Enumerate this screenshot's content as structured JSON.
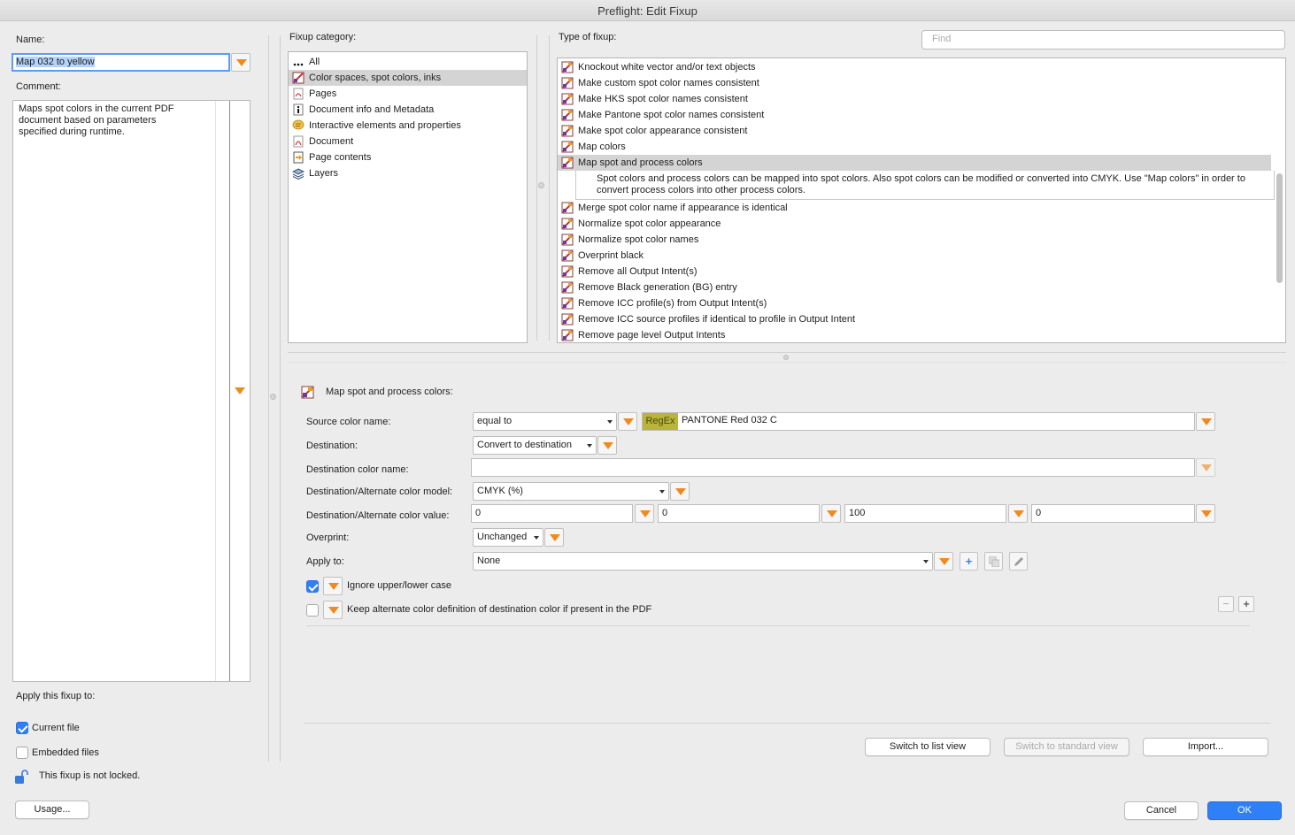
{
  "window": {
    "title": "Preflight: Edit Fixup"
  },
  "left": {
    "name_label": "Name:",
    "name_value": "Map 032 to yellow",
    "comment_label": "Comment:",
    "comment_value": "Maps spot colors in the current PDF document based on parameters specified during runtime.",
    "apply_label": "Apply this fixup to:",
    "current_file": "Current file",
    "embedded_files": "Embedded files",
    "lock_text": "This fixup is not locked.",
    "usage_button": "Usage..."
  },
  "category": {
    "label": "Fixup category:",
    "items": [
      {
        "label": "All",
        "icon": "dots-icon"
      },
      {
        "label": "Color spaces, spot colors, inks",
        "icon": "color-palette-icon",
        "selected": true
      },
      {
        "label": "Pages",
        "icon": "pdf-page-icon"
      },
      {
        "label": "Document info and Metadata",
        "icon": "info-icon"
      },
      {
        "label": "Interactive elements and properties",
        "icon": "comment-bubble-icon"
      },
      {
        "label": "Document",
        "icon": "pdf-document-icon"
      },
      {
        "label": "Page contents",
        "icon": "page-contents-icon"
      },
      {
        "label": "Layers",
        "icon": "layers-icon"
      }
    ]
  },
  "types": {
    "label": "Type of fixup:",
    "find_placeholder": "Find",
    "items": [
      "Knockout white vector and/or text objects",
      "Make custom spot color names consistent",
      "Make HKS spot color names consistent",
      "Make Pantone spot color names consistent",
      "Make spot color appearance consistent",
      "Map colors",
      "Map spot and process colors",
      "Merge spot color name if appearance is identical",
      "Normalize spot color appearance",
      "Normalize spot color names",
      "Overprint black",
      "Remove all Output Intent(s)",
      "Remove Black generation (BG) entry",
      "Remove ICC profile(s) from Output Intent(s)",
      "Remove ICC source profiles if identical to profile in Output Intent",
      "Remove page level Output Intents"
    ],
    "selected_index": 6,
    "selected_description": "Spot colors and process colors can be mapped into spot colors. Also spot colors can be modified or converted into CMYK. Use \"Map colors\" in order to convert process colors into other process colors."
  },
  "params": {
    "header": "Map spot and process colors:",
    "source_label": "Source color name:",
    "source_op": "equal to",
    "regex_badge": "RegEx",
    "source_value": "PANTONE Red 032 C",
    "destination_label": "Destination:",
    "destination_value": "Convert to destination",
    "dest_name_label": "Destination color name:",
    "dest_name_value": "",
    "model_label": "Destination/Alternate color model:",
    "model_value": "CMYK (%)",
    "value_label": "Destination/Alternate color value:",
    "values": [
      "0",
      "0",
      "100",
      "0"
    ],
    "overprint_label": "Overprint:",
    "overprint_value": "Unchanged",
    "apply_to_label": "Apply to:",
    "apply_to_value": "None",
    "ignore_case": "Ignore upper/lower case",
    "keep_alt": "Keep alternate color definition of destination color if present in the PDF"
  },
  "footer": {
    "switch_list": "Switch to list view",
    "switch_standard": "Switch to standard view",
    "import": "Import...",
    "cancel": "Cancel",
    "ok": "OK"
  },
  "colors": {
    "accent": "#2f7ff7",
    "orange": "#ef8a1f",
    "regex": "#b9b43a",
    "selection": "#d4d4d4"
  }
}
